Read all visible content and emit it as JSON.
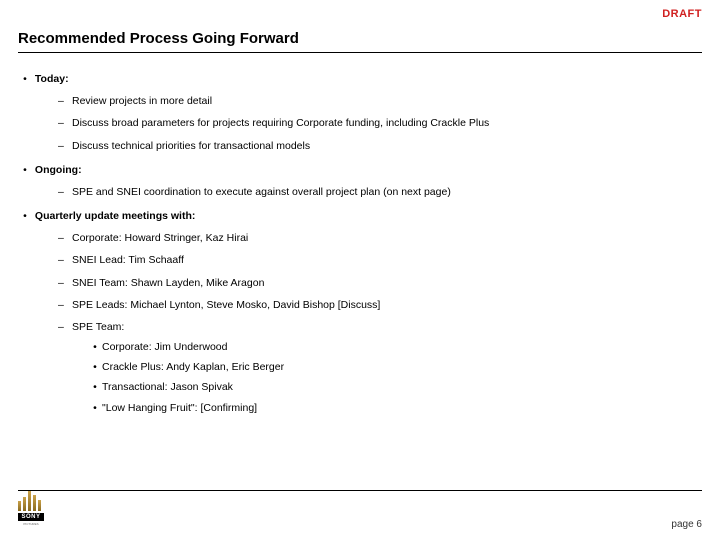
{
  "header": {
    "draft": "DRAFT",
    "title": "Recommended Process Going Forward"
  },
  "sections": [
    {
      "label": "Today:",
      "items": [
        {
          "text": "Review projects in more detail"
        },
        {
          "text": "Discuss broad parameters for projects requiring Corporate funding, including Crackle Plus"
        },
        {
          "text": "Discuss technical priorities for transactional models"
        }
      ]
    },
    {
      "label": "Ongoing:",
      "items": [
        {
          "text": "SPE and SNEI coordination to execute against overall project plan (on next page)"
        }
      ]
    },
    {
      "label": "Quarterly update meetings with:",
      "items": [
        {
          "text": "Corporate: Howard Stringer, Kaz Hirai"
        },
        {
          "text": "SNEI Lead: Tim Schaaff"
        },
        {
          "text": "SNEI Team: Shawn Layden, Mike Aragon"
        },
        {
          "text": "SPE Leads: Michael Lynton, Steve Mosko, David Bishop [Discuss]"
        },
        {
          "text": "SPE Team:",
          "sub": [
            "Corporate: Jim Underwood",
            "Crackle Plus: Andy Kaplan, Eric Berger",
            "Transactional: Jason Spivak",
            "\"Low Hanging Fruit\": [Confirming]"
          ]
        }
      ]
    }
  ],
  "footer": {
    "page": "page 6",
    "logo_word": "SONY",
    "logo_sub": "PICTURES"
  }
}
